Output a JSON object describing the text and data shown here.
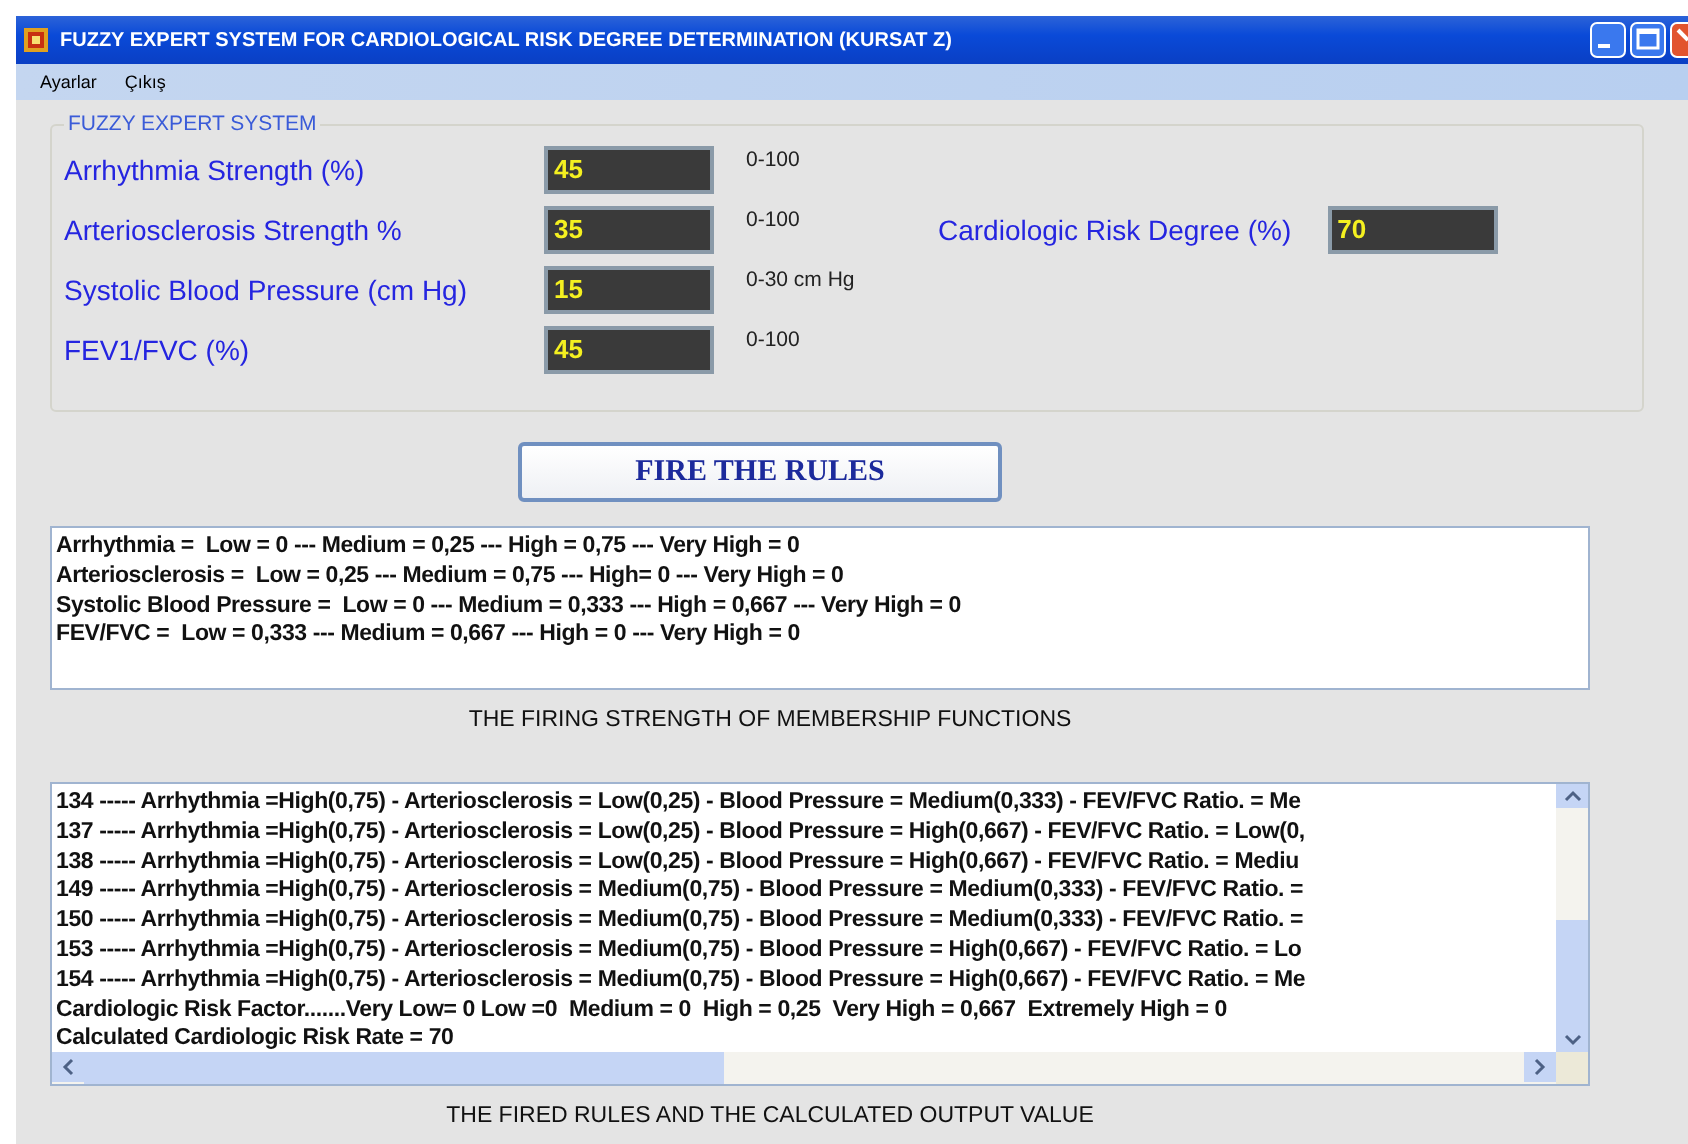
{
  "window": {
    "title": "FUZZY EXPERT SYSTEM FOR CARDIOLOGICAL RISK DEGREE DETERMINATION (KURSAT Z)"
  },
  "menu": [
    "Ayarlar",
    "Çıkış"
  ],
  "group": {
    "title": "FUZZY EXPERT SYSTEM",
    "inputs": [
      {
        "label": "Arrhythmia Strength (%)",
        "value": "45",
        "range": "0-100"
      },
      {
        "label": "Arteriosclerosis Strength %",
        "value": "35",
        "range": "0-100"
      },
      {
        "label": "Systolic Blood Pressure (cm Hg)",
        "value": "15",
        "range": "0-30 cm Hg"
      },
      {
        "label": "FEV1/FVC (%)",
        "value": "45",
        "range": "0-100"
      }
    ],
    "output": {
      "label": "Cardiologic Risk Degree (%)",
      "value": "70"
    }
  },
  "fire_button": "FIRE THE RULES",
  "membership": {
    "lines": [
      "Arrhythmia =  Low = 0 --- Medium = 0,25 --- High = 0,75 --- Very High = 0",
      "Arteriosclerosis =  Low = 0,25 --- Medium = 0,75 --- High= 0 --- Very High = 0",
      "Systolic Blood Pressure =  Low = 0 --- Medium = 0,333 --- High = 0,667 --- Very High = 0",
      "FEV/FVC =  Low = 0,333 --- Medium = 0,667 --- High = 0 --- Very High = 0"
    ],
    "caption": "THE FIRING STRENGTH OF MEMBERSHIP FUNCTIONS"
  },
  "rules": {
    "lines": [
      "134 ----- Arrhythmia =High(0,75) - Arteriosclerosis = Low(0,25) - Blood Pressure = Medium(0,333) - FEV/FVC Ratio. = Me",
      "137 ----- Arrhythmia =High(0,75) - Arteriosclerosis = Low(0,25) - Blood Pressure = High(0,667) - FEV/FVC Ratio. = Low(0,",
      "138 ----- Arrhythmia =High(0,75) - Arteriosclerosis = Low(0,25) - Blood Pressure = High(0,667) - FEV/FVC Ratio. = Mediu",
      "149 ----- Arrhythmia =High(0,75) - Arteriosclerosis = Medium(0,75) - Blood Pressure = Medium(0,333) - FEV/FVC Ratio. =",
      "150 ----- Arrhythmia =High(0,75) - Arteriosclerosis = Medium(0,75) - Blood Pressure = Medium(0,333) - FEV/FVC Ratio. =",
      "153 ----- Arrhythmia =High(0,75) - Arteriosclerosis = Medium(0,75) - Blood Pressure = High(0,667) - FEV/FVC Ratio. = Lo",
      "154 ----- Arrhythmia =High(0,75) - Arteriosclerosis = Medium(0,75) - Blood Pressure = High(0,667) - FEV/FVC Ratio. = Me",
      "Cardiologic Risk Factor.......Very Low= 0 Low =0  Medium = 0  High = 0,25  Very High = 0,667  Extremely High = 0",
      "Calculated Cardiologic Risk Rate = 70"
    ],
    "caption": "THE FIRED RULES AND THE CALCULATED OUTPUT VALUE"
  }
}
